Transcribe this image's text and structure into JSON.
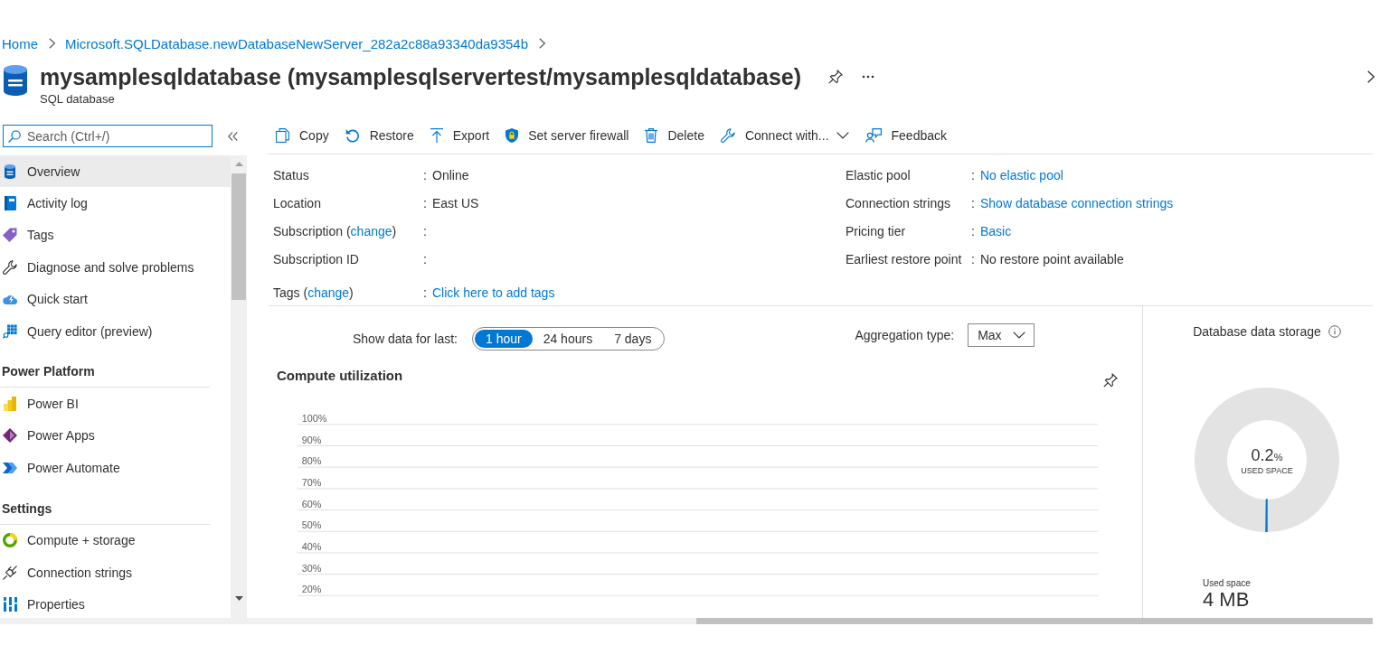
{
  "breadcrumb": [
    {
      "label": "Home"
    },
    {
      "label": "Microsoft.SQLDatabase.newDatabaseNewServer_282a2c88a93340da9354b"
    }
  ],
  "header": {
    "title": "mysamplesqldatabase (mysamplesqlservertest/mysamplesqldatabase)",
    "subtitle": "SQL database"
  },
  "sidebar": {
    "search": {
      "placeholder": "Search (Ctrl+/)"
    },
    "sections": [
      {
        "items": [
          {
            "label": "Overview",
            "selected": true
          },
          {
            "label": "Activity log",
            "selected": false
          },
          {
            "label": "Tags",
            "selected": false
          },
          {
            "label": "Diagnose and solve problems",
            "selected": false
          },
          {
            "label": "Quick start",
            "selected": false
          },
          {
            "label": "Query editor (preview)",
            "selected": false
          }
        ]
      },
      {
        "heading": "Power Platform",
        "items": [
          {
            "label": "Power BI",
            "selected": false
          },
          {
            "label": "Power Apps",
            "selected": false
          },
          {
            "label": "Power Automate",
            "selected": false
          }
        ]
      },
      {
        "heading": "Settings",
        "items": [
          {
            "label": "Compute + storage",
            "selected": false
          },
          {
            "label": "Connection strings",
            "selected": false
          },
          {
            "label": "Properties",
            "selected": false
          }
        ]
      }
    ]
  },
  "toolbar": [
    {
      "label": "Copy",
      "kind": "button"
    },
    {
      "label": "Restore",
      "kind": "button"
    },
    {
      "label": "Export",
      "kind": "button"
    },
    {
      "label": "Set server firewall",
      "kind": "button"
    },
    {
      "label": "Delete",
      "kind": "button"
    },
    {
      "label": "Connect with...",
      "kind": "menu"
    },
    {
      "label": "Feedback",
      "kind": "button"
    }
  ],
  "essentials": {
    "left": [
      {
        "label": "Status",
        "sep": ":",
        "value": "Online",
        "kind": "text"
      },
      {
        "label": "Location",
        "sep": ":",
        "value": "East US",
        "kind": "text"
      },
      {
        "label": "Subscription (",
        "label_link": "change",
        "label_end": ")",
        "sep": ":"
      },
      {
        "label": "Subscription ID",
        "sep": ":"
      }
    ],
    "right": [
      {
        "label": "Elastic pool",
        "sep": ":",
        "value": "No elastic pool",
        "kind": "link"
      },
      {
        "label": "Connection strings",
        "sep": ":",
        "value": "Show database connection strings",
        "kind": "link"
      },
      {
        "label": "Pricing tier",
        "sep": ":",
        "value": "Basic",
        "kind": "link"
      },
      {
        "label": "Earliest restore point",
        "sep": ":",
        "value": "No restore point available",
        "kind": "text"
      }
    ],
    "tags": {
      "label": "Tags (",
      "label_link": "change",
      "label_end": ")",
      "sep": ":",
      "value": "Click here to add tags",
      "kind": "link"
    }
  },
  "time_range": {
    "label": "Show data for last:",
    "options": [
      {
        "label": "1 hour",
        "selected": true
      },
      {
        "label": "24 hours",
        "selected": false
      },
      {
        "label": "7 days",
        "selected": false
      }
    ]
  },
  "aggregation": {
    "label": "Aggregation type:",
    "value": "Max"
  },
  "compute_chart": {
    "title": "Compute utilization",
    "y_labels": [
      "100%",
      "90%",
      "80%",
      "70%",
      "60%",
      "50%",
      "40%",
      "30%",
      "20%"
    ]
  },
  "storage": {
    "chart_data": {
      "type": "donut",
      "title": "Database data storage",
      "values": [
        0.2,
        99.8
      ]
    },
    "percent": "0.2",
    "percent_unit": "%",
    "center_caption": "USED SPACE",
    "used_label": "Used space",
    "used_value": "4 MB"
  }
}
